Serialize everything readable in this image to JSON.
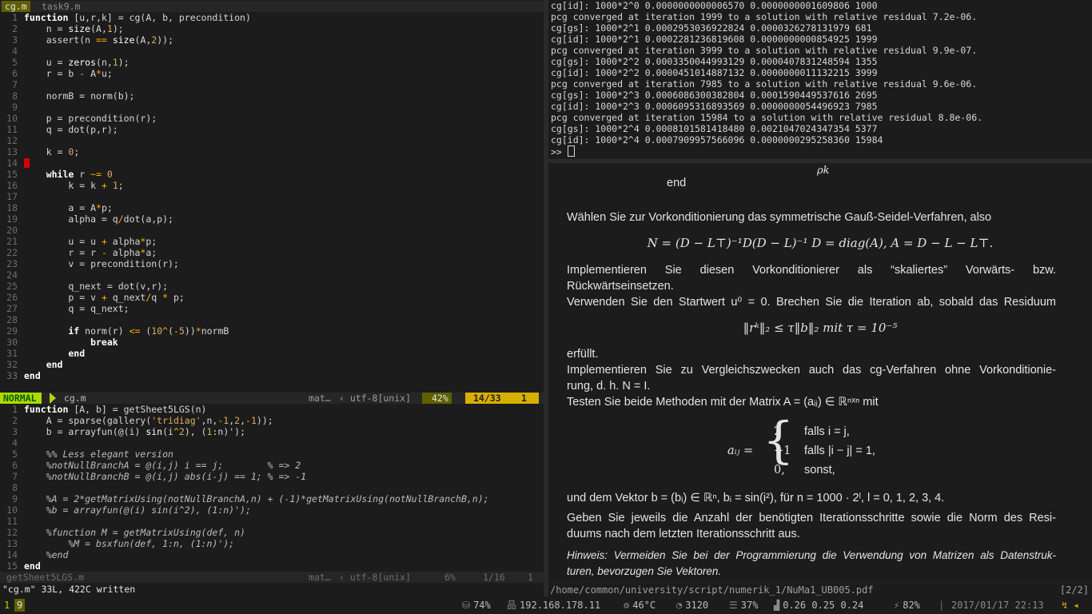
{
  "tabs": [
    {
      "label": "cg.m"
    },
    {
      "label": "task9.m"
    }
  ],
  "cg": {
    "lines": [
      [
        {
          "c": "kw",
          "t": "function"
        },
        {
          "t": " [u,r,k] = cg(A, b, precondition)"
        }
      ],
      [
        {
          "t": "    n = "
        },
        {
          "c": "fn",
          "t": "size"
        },
        {
          "t": "(A,"
        },
        {
          "c": "num",
          "t": "1"
        },
        {
          "t": ");"
        }
      ],
      [
        {
          "t": "    assert(n "
        },
        {
          "c": "op",
          "t": "=="
        },
        {
          "t": " "
        },
        {
          "c": "fn",
          "t": "size"
        },
        {
          "t": "(A,"
        },
        {
          "c": "num",
          "t": "2"
        },
        {
          "t": "));"
        }
      ],
      [],
      [
        {
          "t": "    u = "
        },
        {
          "c": "fn",
          "t": "zeros"
        },
        {
          "t": "(n,"
        },
        {
          "c": "num",
          "t": "1"
        },
        {
          "t": ");"
        }
      ],
      [
        {
          "t": "    r = b "
        },
        {
          "c": "op",
          "t": "-"
        },
        {
          "t": " A"
        },
        {
          "c": "op",
          "t": "*"
        },
        {
          "t": "u;"
        }
      ],
      [],
      [
        {
          "t": "    normB = norm(b);"
        }
      ],
      [],
      [
        {
          "t": "    p = precondition(r);"
        }
      ],
      [
        {
          "t": "    q = dot(p,r);"
        }
      ],
      [],
      [
        {
          "t": "    k = "
        },
        {
          "c": "num",
          "t": "0"
        },
        {
          "t": ";"
        }
      ],
      [],
      [
        {
          "c": "kw",
          "t": "    while"
        },
        {
          "t": " r "
        },
        {
          "c": "op",
          "t": "~="
        },
        {
          "t": " "
        },
        {
          "c": "num",
          "t": "0"
        }
      ],
      [
        {
          "t": "        k = k "
        },
        {
          "c": "op",
          "t": "+"
        },
        {
          "t": " "
        },
        {
          "c": "num",
          "t": "1"
        },
        {
          "t": ";"
        }
      ],
      [],
      [
        {
          "t": "        a = A"
        },
        {
          "c": "op",
          "t": "*"
        },
        {
          "t": "p;"
        }
      ],
      [
        {
          "t": "        alpha = q"
        },
        {
          "c": "op",
          "t": "/"
        },
        {
          "t": "dot(a,p);"
        }
      ],
      [],
      [
        {
          "t": "        u = u "
        },
        {
          "c": "op",
          "t": "+"
        },
        {
          "t": " alpha"
        },
        {
          "c": "op",
          "t": "*"
        },
        {
          "t": "p;"
        }
      ],
      [
        {
          "t": "        r = r "
        },
        {
          "c": "op",
          "t": "-"
        },
        {
          "t": " alpha"
        },
        {
          "c": "op",
          "t": "*"
        },
        {
          "t": "a;"
        }
      ],
      [
        {
          "t": "        v = precondition(r);"
        }
      ],
      [],
      [
        {
          "t": "        q_next = dot(v,r);"
        }
      ],
      [
        {
          "t": "        p = v "
        },
        {
          "c": "op",
          "t": "+"
        },
        {
          "t": " q_next"
        },
        {
          "c": "op",
          "t": "/"
        },
        {
          "t": "q "
        },
        {
          "c": "op",
          "t": "*"
        },
        {
          "t": " p;"
        }
      ],
      [
        {
          "t": "        q = q_next;"
        }
      ],
      [],
      [
        {
          "c": "kw",
          "t": "        if"
        },
        {
          "t": " norm(r) "
        },
        {
          "c": "op",
          "t": "<="
        },
        {
          "t": " ("
        },
        {
          "c": "num",
          "t": "10"
        },
        {
          "c": "op",
          "t": "^"
        },
        {
          "t": "("
        },
        {
          "c": "op",
          "t": "-"
        },
        {
          "c": "num",
          "t": "5"
        },
        {
          "t": "))"
        },
        {
          "c": "op",
          "t": "*"
        },
        {
          "t": "normB"
        }
      ],
      [
        {
          "c": "kw",
          "t": "            break"
        }
      ],
      [
        {
          "c": "kw",
          "t": "        end"
        }
      ],
      [
        {
          "c": "kw",
          "t": "    end"
        }
      ],
      [
        {
          "c": "kw",
          "t": "end"
        }
      ]
    ]
  },
  "status_top": {
    "mode": "NORMAL",
    "file": "cg.m",
    "filetype": "mat…",
    "encoding": "utf-8[unix]",
    "percent": "42%",
    "line_col": "14/33",
    "col": "1"
  },
  "gs": {
    "lines": [
      [
        {
          "c": "kw",
          "t": "function"
        },
        {
          "t": " [A, b] = getSheet5LGS(n)"
        }
      ],
      [
        {
          "t": "    A = sparse(gallery("
        },
        {
          "c": "str",
          "t": "'tridiag'"
        },
        {
          "t": ",n,"
        },
        {
          "c": "op",
          "t": "-"
        },
        {
          "c": "num",
          "t": "1"
        },
        {
          "t": ","
        },
        {
          "c": "num",
          "t": "2"
        },
        {
          "t": ","
        },
        {
          "c": "op",
          "t": "-"
        },
        {
          "c": "num",
          "t": "1"
        },
        {
          "t": "));"
        }
      ],
      [
        {
          "t": "    b = arrayfun(@(i) "
        },
        {
          "c": "fn",
          "t": "sin"
        },
        {
          "t": "(i"
        },
        {
          "c": "op",
          "t": "^"
        },
        {
          "c": "num",
          "t": "2"
        },
        {
          "t": "), ("
        },
        {
          "c": "num",
          "t": "1"
        },
        {
          "t": ":n)');"
        }
      ],
      [],
      [
        {
          "c": "cmt",
          "t": "    %% Less elegant version"
        }
      ],
      [
        {
          "c": "cmt",
          "t": "    %notNullBranchA = @(i,j) i == j;        % => 2"
        }
      ],
      [
        {
          "c": "cmt",
          "t": "    %notNullBranchB = @(i,j) abs(i-j) == 1; % => -1"
        }
      ],
      [],
      [
        {
          "c": "cmt",
          "t": "    %A = 2*getMatrixUsing(notNullBranchA,n) + (-1)*getMatrixUsing(notNullBranchB,n);"
        }
      ],
      [
        {
          "c": "cmt",
          "t": "    %b = arrayfun(@(i) sin(i^2), (1:n)');"
        }
      ],
      [],
      [
        {
          "c": "cmt",
          "t": "    %function M = getMatrixUsing(def, n)"
        }
      ],
      [
        {
          "c": "cmt",
          "t": "        %M = bsxfun(def, 1:n, (1:n)');"
        }
      ],
      [
        {
          "c": "cmt",
          "t": "    %end"
        }
      ],
      [
        {
          "c": "kw",
          "t": "end"
        }
      ]
    ]
  },
  "status_bottom": {
    "file": "getSheet5LGS.m",
    "filetype": "mat…",
    "encoding": "utf-8[unix]",
    "percent": "6%",
    "line_col": "1/16",
    "col": "1"
  },
  "cmdline": "\"cg.m\" 33L, 422C written",
  "terminal": {
    "lines": [
      "cg[id]: 1000*2^0 0.0000000000006570 0.0000000001609806 1000",
      "pcg converged at iteration 1999 to a solution with relative residual 7.2e-06.",
      "cg[gs]: 1000*2^1 0.0002953036922824 0.0000326278131979 681",
      "cg[id]: 1000*2^1 0.0002281236819608 0.0000000000854925 1999",
      "pcg converged at iteration 3999 to a solution with relative residual 9.9e-07.",
      "cg[gs]: 1000*2^2 0.0003350044993129 0.0000407831248594 1355",
      "cg[id]: 1000*2^2 0.0000451014887132 0.0000000011132215 3999",
      "pcg converged at iteration 7985 to a solution with relative residual 9.6e-06.",
      "cg[gs]: 1000*2^3 0.0006086300382804 0.0001590449537616 2695",
      "cg[id]: 1000*2^3 0.0006095316893569 0.0000000054496923 7985",
      "pcg converged at iteration 15984 to a solution with relative residual 8.8e-06.",
      "cg[gs]: 1000*2^4 0.0008101581418480 0.0021047024347354 5377",
      "cg[id]: 1000*2^4 0.0007909957566096 0.0000000295258360 15984"
    ],
    "prompt": ">> "
  },
  "pdf": {
    "rho": "ρk",
    "end": "end",
    "p1": "Wählen Sie zur Vorkonditionierung das symmetrische Gauß-Seidel-Verfahren, also",
    "eq1": "N = (D − L⊤)⁻¹D(D − L)⁻¹        D = diag(A),    A = D − L − L⊤.",
    "p2a": "Implementieren Sie diesen Vorkonditionierer als “skaliertes” Vorwärts- bzw.",
    "p2b": "Rückwärtseinsetzen.",
    "p3": "Verwenden Sie den Startwert u⁰ = 0. Brechen Sie die Iteration ab, sobald das Residuum",
    "eq2": "‖rᵏ‖₂ ≤ τ‖b‖₂    mit    τ = 10⁻⁵",
    "p4": "erfüllt.",
    "p5a": "Implementieren Sie zu Vergleichszwecken auch das cg-Verfahren ohne Vorkonditionie-",
    "p5b": "rung, d. h. N = I.",
    "p6": "Testen Sie beide Methoden mit der Matrix A = (aᵢⱼ) ∈ ℝⁿˣⁿ mit",
    "aij": "aᵢⱼ =",
    "case1v": "2",
    "case1c": "falls i = j,",
    "case2v": "−1",
    "case2c": "falls |i − j| = 1,",
    "case3v": "0,",
    "case3c": "sonst,",
    "p7": "und dem Vektor b = (bᵢ) ∈ ℝⁿ, bᵢ = sin(i²), für n = 1000 · 2ˡ, l = 0, 1, 2, 3, 4.",
    "p8a": "Geben Sie jeweils die Anzahl der benötigten Iterationsschritte sowie die Norm des Resi-",
    "p8b": "duums nach dem letzten Iterationsschritt aus.",
    "p9a": "Hinweis: Vermeiden Sie bei der Programmierung die Verwendung von Matrizen als Datenstruk-",
    "p9b": "turen, bevorzugen Sie Vektoren.",
    "path": "/home/common/university/script/numerik_1/NuMa1_UB005.pdf",
    "page": "[2/2]"
  },
  "bar": {
    "ws1": "1",
    "ws2": "9",
    "disk": "74%",
    "ip": "192.168.178.11",
    "temp": "46°C",
    "cpu": "3120",
    "mem": "37%",
    "load": "0.26 0.25 0.24",
    "battery": "82%",
    "datetime": "2017/01/17 22:13",
    "tray": "↯ ◂"
  },
  "colors": {
    "accent": "#afd700",
    "mode_fg": "#005f00",
    "position_bg": "#d7af00",
    "keyword": "#ffffff",
    "number": "#d7af5f",
    "operator": "#ffaf00",
    "cursor_mark": "#d70000"
  }
}
